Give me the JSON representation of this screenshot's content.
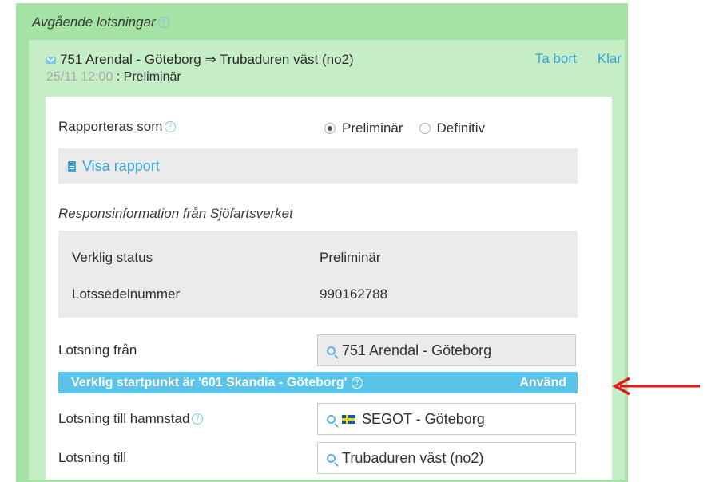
{
  "section": {
    "title": "Avgående lotsningar"
  },
  "item": {
    "route": "751 Arendal - Göteborg ⇒ Trubaduren väst (no2)",
    "timestamp": "25/11 12:00",
    "status_suffix": " : Preliminär",
    "remove_label": "Ta bort",
    "done_label": "Klar"
  },
  "form": {
    "reported_as_label": "Rapporteras som",
    "radio_options": [
      "Preliminär",
      "Definitiv"
    ],
    "selected_option": "Preliminär",
    "show_report_label": "Visa rapport",
    "response_title": "Responsinformation från Sjöfartsverket",
    "response": [
      {
        "key": "Verklig status",
        "value": "Preliminär"
      },
      {
        "key": "Lotssedelnummer",
        "value": "990162788"
      }
    ],
    "from_label": "Lotsning från",
    "from_value": "751 Arendal - Göteborg",
    "notice_text": "Verklig startpunkt är '601 Skandia - Göteborg'",
    "notice_action": "Använd",
    "to_port_label": "Lotsning till hamnstad",
    "to_port_value": "SEGOT - Göteborg",
    "to_label": "Lotsning till",
    "to_value": "Trubaduren väst (no2)"
  },
  "colors": {
    "outer_bg": "#a5e3a5",
    "inner_bg": "#c6eec6",
    "link": "#3aa4d8",
    "notice_bg": "#5bc4ea",
    "annotation_arrow": "#e81818"
  },
  "icons": {
    "help": "question-circle-icon",
    "mail": "envelope-icon",
    "report": "document-icon",
    "search": "search-icon",
    "flag": "sweden-flag-icon",
    "annotation": "red-arrow-icon"
  }
}
